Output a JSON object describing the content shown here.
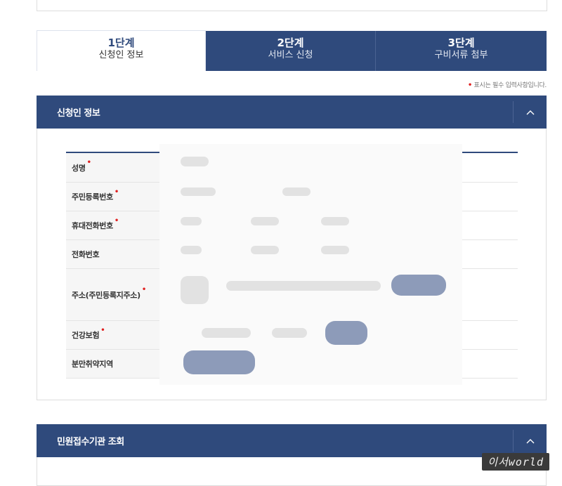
{
  "steps": [
    {
      "num": "1단계",
      "title": "신청인 정보",
      "active": true
    },
    {
      "num": "2단계",
      "title": "서비스 신청",
      "active": false
    },
    {
      "num": "3단계",
      "title": "구비서류 첨부",
      "active": false
    }
  ],
  "required_note": "표시는 필수 입력사항입니다.",
  "required_marker": "•",
  "sections": {
    "applicant": {
      "title": "신청인 정보"
    },
    "office_lookup": {
      "title": "민원접수기관 조회"
    }
  },
  "form": {
    "rows": [
      {
        "label": "성명",
        "required": true
      },
      {
        "label": "주민등록번호",
        "required": true
      },
      {
        "label": "휴대전화번호",
        "required": true
      },
      {
        "label": "전화번호",
        "required": false
      },
      {
        "label": "주소(주민등록지주소)",
        "required": true
      },
      {
        "label": "건강보험",
        "required": true
      },
      {
        "label": "분만취약지역",
        "required": false
      }
    ]
  },
  "icons": {
    "toggle": "chevron-up-icon"
  },
  "colors": {
    "primary": "#2f4a7c",
    "required": "#e02020",
    "label_bg": "#f6f6f6"
  },
  "watermark": "이서world"
}
